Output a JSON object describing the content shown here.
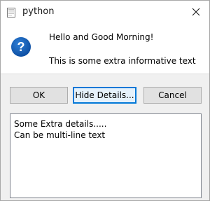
{
  "window": {
    "title": "python"
  },
  "message": {
    "icon": "question-icon",
    "main_text": "Hello and Good Morning!",
    "informative_text": "This is some extra informative text"
  },
  "buttons": {
    "ok_label": "OK",
    "details_label": "Hide Details...",
    "cancel_label": "Cancel"
  },
  "details": {
    "text": "Some Extra details.....\nCan be multi-line text"
  },
  "colors": {
    "accent": "#0078d7",
    "icon_blue": "#1565c0",
    "button_bg": "#e1e1e1",
    "panel_bg": "#f0f0f0"
  }
}
